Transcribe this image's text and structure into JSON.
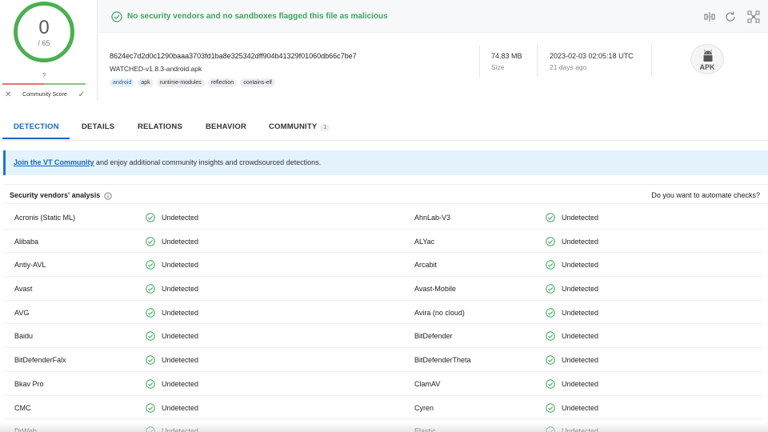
{
  "score": {
    "detections": "0",
    "total": "/ 65",
    "community_score_value": "?",
    "community_score_label": "Community Score",
    "colors": {
      "ring": "#4caf50",
      "bad": "#e57373",
      "good": "#81c784"
    }
  },
  "verdict": {
    "text": "No security vendors and no sandboxes flagged this file as malicious",
    "color": "#3ba55c",
    "icon": "check-circle-icon"
  },
  "toolbar": {
    "icons": [
      "compare-icon",
      "reanalyze-icon",
      "graph-icon"
    ]
  },
  "file": {
    "hash": "8624ec7d2d0c1290baaa3703fd1ba8e325342dff904b41329f01060db66c7be7",
    "name": "WATCHED-v1.8.3-android.apk",
    "tags": [
      "android",
      "apk",
      "runtime-modules",
      "reflection",
      "contains-elf"
    ],
    "size_value": "74.83 MB",
    "size_label": "Size",
    "date_value": "2023-02-03 02:05:18 UTC",
    "date_label": "21 days ago",
    "type_badge": "APK",
    "type_icon": "android-icon"
  },
  "tabs": [
    {
      "label": "DETECTION"
    },
    {
      "label": "DETAILS"
    },
    {
      "label": "RELATIONS"
    },
    {
      "label": "BEHAVIOR"
    },
    {
      "label": "COMMUNITY",
      "badge": "1"
    }
  ],
  "banner": {
    "link": "Join the VT Community",
    "text": " and enjoy additional community insights and crowdsourced detections."
  },
  "analysis": {
    "title": "Security vendors' analysis",
    "automate": "Do you want to automate checks?"
  },
  "vendors": [
    [
      "Acronis (Static ML)",
      "Undetected",
      "AhnLab-V3",
      "Undetected"
    ],
    [
      "Alibaba",
      "Undetected",
      "ALYac",
      "Undetected"
    ],
    [
      "Antiy-AVL",
      "Undetected",
      "Arcabit",
      "Undetected"
    ],
    [
      "Avast",
      "Undetected",
      "Avast-Mobile",
      "Undetected"
    ],
    [
      "AVG",
      "Undetected",
      "Avira (no cloud)",
      "Undetected"
    ],
    [
      "Baidu",
      "Undetected",
      "BitDefender",
      "Undetected"
    ],
    [
      "BitDefenderFalx",
      "Undetected",
      "BitDefenderTheta",
      "Undetected"
    ],
    [
      "Bkav Pro",
      "Undetected",
      "ClamAV",
      "Undetected"
    ],
    [
      "CMC",
      "Undetected",
      "Cyren",
      "Undetected"
    ],
    [
      "DrWeb",
      "Undetected",
      "Elastic",
      "Undetected"
    ]
  ]
}
